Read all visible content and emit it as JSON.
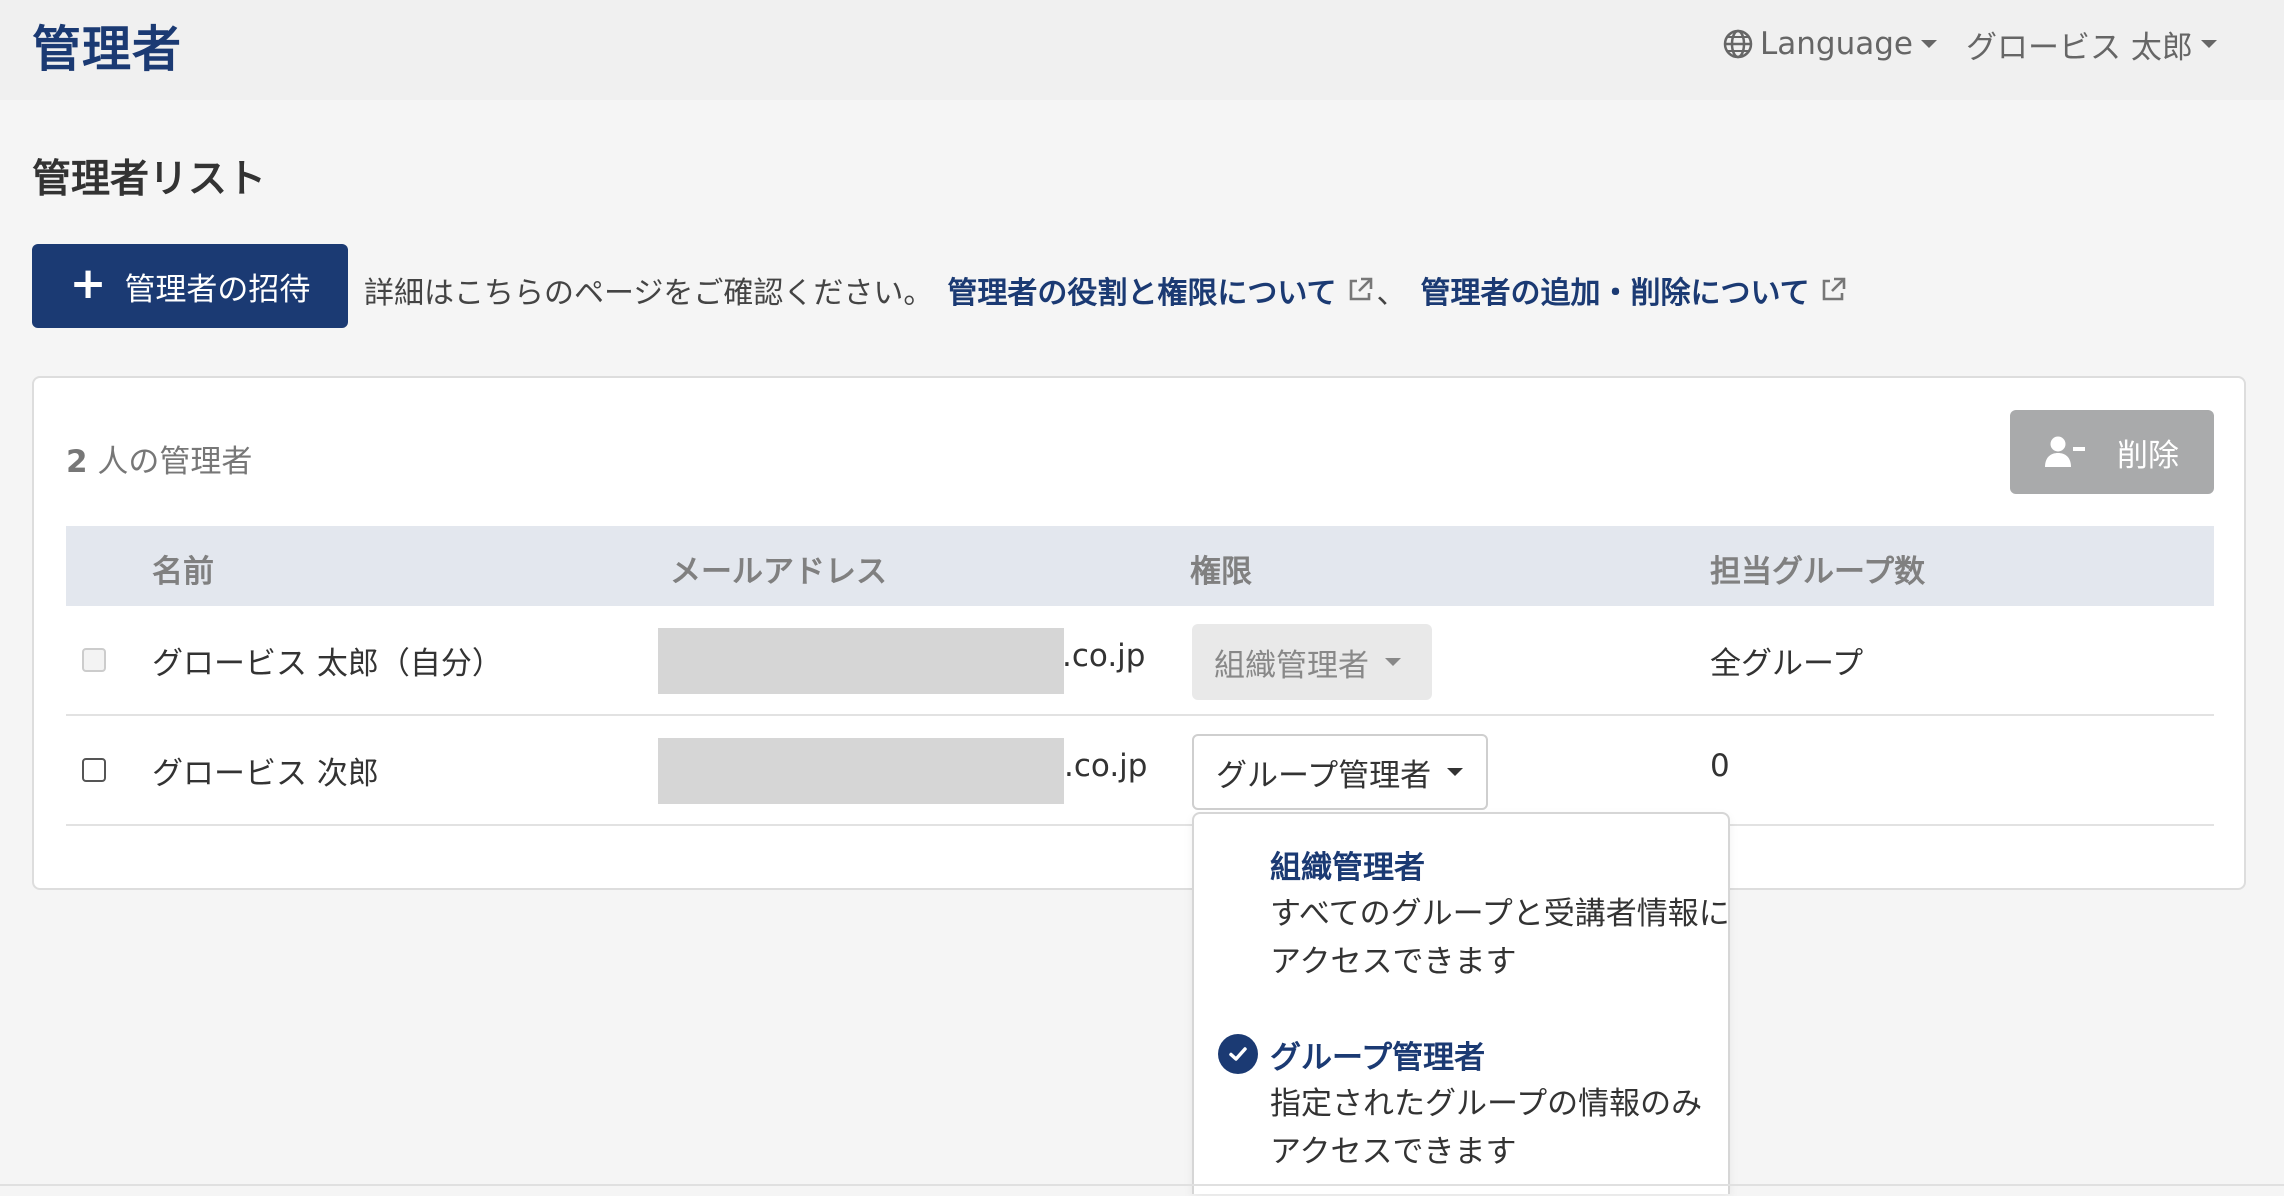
{
  "header": {
    "app_title": "管理者",
    "language_label": "Language",
    "user_name": "グロービス 太郎"
  },
  "page": {
    "title": "管理者リスト",
    "invite_button": "管理者の招待",
    "info_text": "詳細はこちらのページをご確認ください。",
    "link_roles": "管理者の役割と権限について",
    "separator": "、",
    "link_add_remove": "管理者の追加・削除について"
  },
  "card": {
    "count_number": "2",
    "count_suffix": " 人の管理者",
    "delete_button": "削除"
  },
  "table": {
    "headers": {
      "name": "名前",
      "email": "メールアドレス",
      "role": "権限",
      "groups": "担当グループ数"
    },
    "rows": [
      {
        "name": "グロービス 太郎（自分）",
        "email_suffix": ".co.jp",
        "role": "組織管理者",
        "groups": "全グループ",
        "checkbox_disabled": true
      },
      {
        "name": "グロービス 次郎",
        "email_suffix": ".co.jp",
        "role": "グループ管理者",
        "groups": "0",
        "checkbox_disabled": false
      }
    ]
  },
  "role_dropdown": {
    "options": [
      {
        "title": "組織管理者",
        "desc_line1": "すべてのグループと受講者情報に",
        "desc_line2": "アクセスできます",
        "selected": false
      },
      {
        "title": "グループ管理者",
        "desc_line1": "指定されたグループの情報のみ",
        "desc_line2": "アクセスできます",
        "selected": true
      }
    ]
  },
  "icons": {
    "globe": "globe-icon",
    "plus": "plus-icon",
    "external_link": "external-link-icon",
    "remove_user": "remove-user-icon",
    "check": "check-circle-icon",
    "caret": "caret-down-icon"
  },
  "colors": {
    "brand": "#1b3a73",
    "disabled_button": "#a9aaab",
    "table_header_bg": "#e3e7ee",
    "redaction": "#d6d6d6"
  }
}
